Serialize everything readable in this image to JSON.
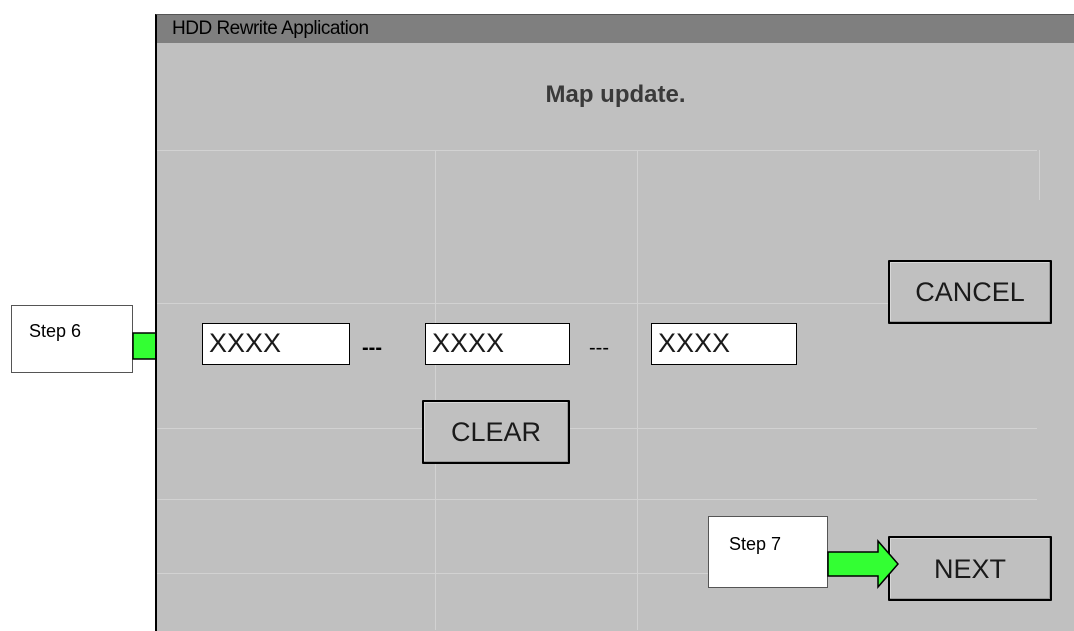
{
  "window": {
    "title": "HDD Rewrite Application",
    "heading": "Map update."
  },
  "code_fields": [
    {
      "value": "XXXX"
    },
    {
      "value": "XXXX"
    },
    {
      "value": "XXXX"
    }
  ],
  "separators": [
    "---",
    "---"
  ],
  "buttons": {
    "cancel": "CANCEL",
    "clear": "CLEAR",
    "next": "NEXT"
  },
  "callouts": {
    "step6": "Step 6",
    "step7": "Step 7"
  },
  "colors": {
    "panel": "#c0c0c0",
    "titlebar": "#7f7f7f",
    "arrow_fill": "#33ff33"
  },
  "icons": {
    "pointer_arrow": "green-arrow-icon"
  }
}
